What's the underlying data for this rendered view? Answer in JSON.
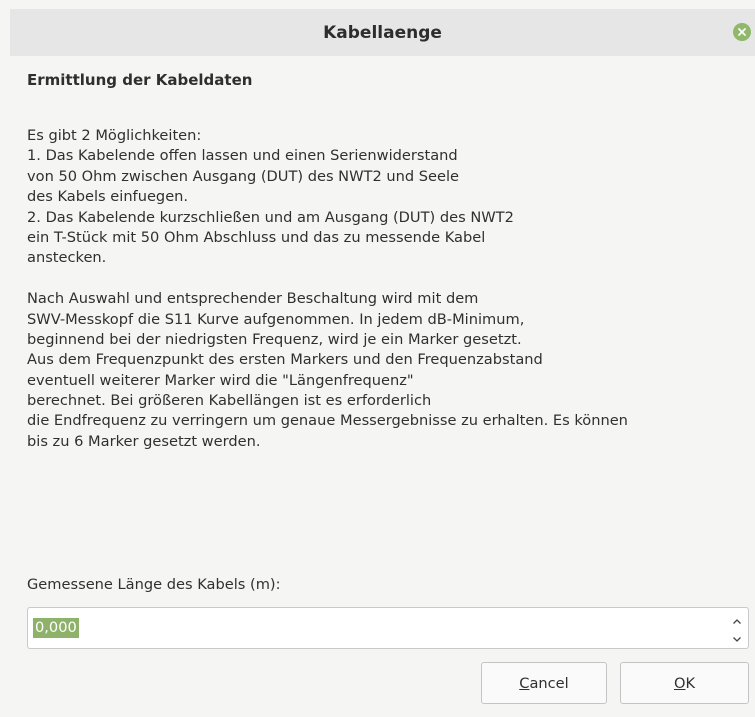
{
  "window": {
    "title": "Kabellaenge"
  },
  "dialog": {
    "heading": "Ermittlung der Kabeldaten",
    "description_lines": [
      "Es gibt 2 Möglichkeiten:",
      "1. Das Kabelende offen lassen und einen Serienwiderstand",
      "von 50 Ohm zwischen Ausgang (DUT) des NWT2 und Seele",
      "des Kabels einfuegen.",
      "2. Das Kabelende kurzschließen und am Ausgang (DUT) des NWT2",
      "ein T-Stück mit 50 Ohm Abschluss und das zu messende Kabel",
      "anstecken.",
      "",
      "Nach Auswahl und entsprechender Beschaltung wird mit dem",
      "SWV-Messkopf die S11 Kurve aufgenommen. In jedem dB-Minimum,",
      "beginnend bei der niedrigsten Frequenz, wird je ein Marker gesetzt.",
      "Aus dem Frequenzpunkt des ersten Markers und den Frequenzabstand",
      "eventuell weiterer Marker wird die \"Längenfrequenz\"",
      "berechnet. Bei größeren Kabellängen ist es erforderlich",
      "die Endfrequenz zu verringern um genaue Messergebnisse zu erhalten. Es können",
      "bis zu 6 Marker gesetzt werden."
    ],
    "field_label": "Gemessene Länge des Kabels (m):",
    "field_value": "0,000",
    "cancel": {
      "mnemonic": "C",
      "rest": "ancel"
    },
    "ok": {
      "mnemonic": "O",
      "rest": "K"
    }
  },
  "icons": {
    "close": "close-icon",
    "spin_up": "chevron-up-icon",
    "spin_down": "chevron-down-icon"
  },
  "colors": {
    "close_button": "#8fb86a",
    "selection": "#8fb26a"
  }
}
